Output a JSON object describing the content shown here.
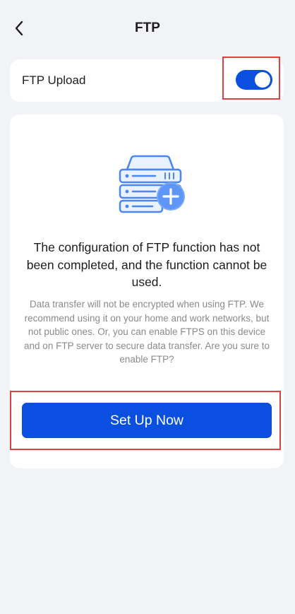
{
  "header": {
    "title": "FTP",
    "back_icon": "chevron-left-icon"
  },
  "ftp_upload": {
    "label": "FTP Upload",
    "enabled": true,
    "toggle_color": "#0a4fe0"
  },
  "info": {
    "illustration_icon": "server-add-icon",
    "heading": "The configuration of FTP function has not been completed, and the function cannot be used.",
    "description": "Data transfer will not be encrypted when using FTP. We recommend using it on your home and work networks, but not public ones. Or, you can enable FTPS on this device and on FTP server to secure data transfer. Are you sure to enable FTP?",
    "button_label": "Set Up Now",
    "button_color": "#0a4fe0"
  },
  "highlight_color": "#e0403d"
}
